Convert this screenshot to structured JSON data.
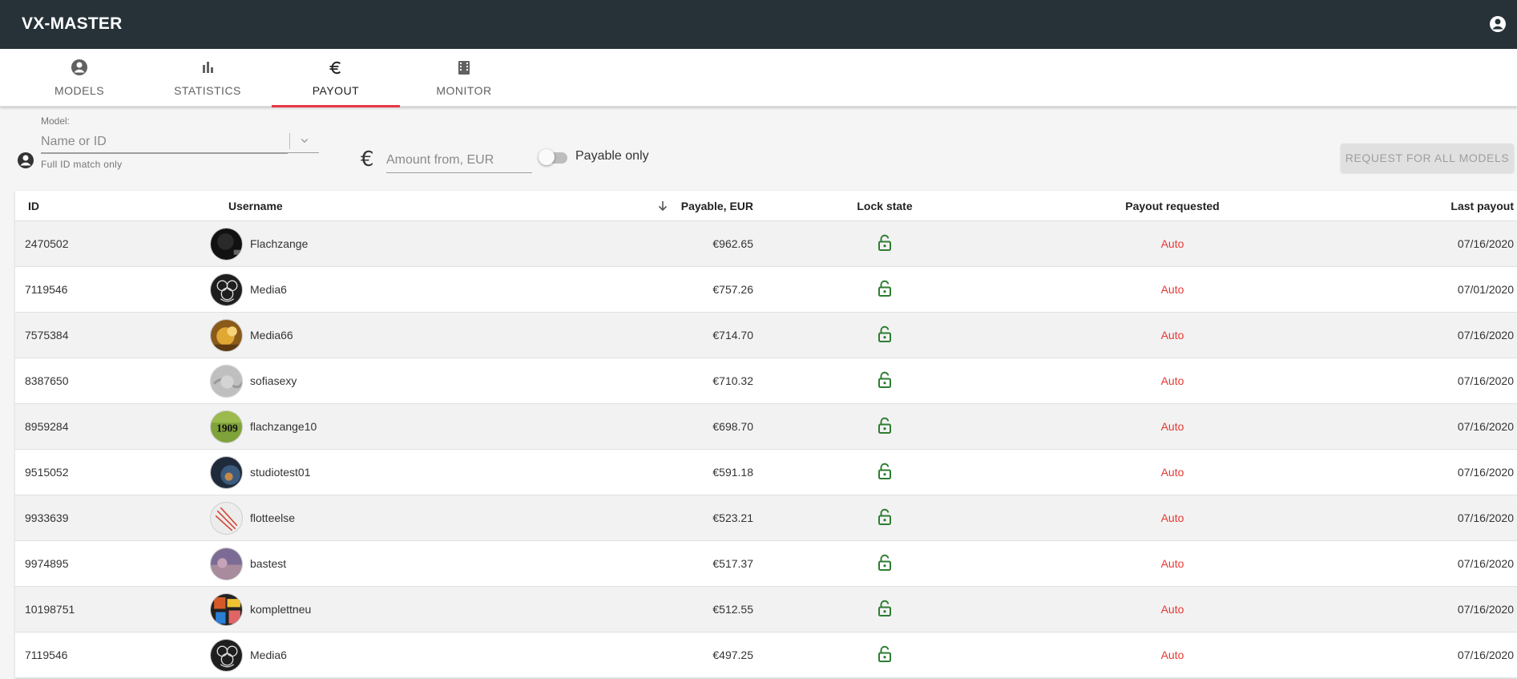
{
  "app": {
    "title": "VX-MASTER"
  },
  "tabs": [
    {
      "label": "MODELS",
      "icon": "account-circle-icon"
    },
    {
      "label": "STATISTICS",
      "icon": "bar-chart-icon"
    },
    {
      "label": "PAYOUT",
      "icon": "euro-icon",
      "active": true
    },
    {
      "label": "MONITOR",
      "icon": "video-monitor-icon"
    }
  ],
  "filters": {
    "model_label": "Model:",
    "model_placeholder": "Name or ID",
    "model_hint": "Full ID match only",
    "amount_placeholder": "Amount from, EUR",
    "payable_only_label": "Payable only",
    "payable_only_checked": false,
    "request_button": "REQUEST FOR ALL MODELS"
  },
  "table": {
    "headers": {
      "id": "ID",
      "username": "Username",
      "payable": "Payable, EUR",
      "lock_state": "Lock state",
      "payout_requested": "Payout requested",
      "last_payout": "Last payout"
    },
    "sort": {
      "column": "payable",
      "direction": "desc"
    },
    "rows": [
      {
        "id": "2470502",
        "username": "Flachzange",
        "payable": "€962.65",
        "lock": "unlocked",
        "requested": "Auto",
        "last": "07/16/2020",
        "avatar": "dark"
      },
      {
        "id": "7119546",
        "username": "Media6",
        "payable": "€757.26",
        "lock": "unlocked",
        "requested": "Auto",
        "last": "07/01/2020",
        "avatar": "ornament"
      },
      {
        "id": "7575384",
        "username": "Media66",
        "payable": "€714.70",
        "lock": "unlocked",
        "requested": "Auto",
        "last": "07/16/2020",
        "avatar": "gold"
      },
      {
        "id": "8387650",
        "username": "sofiasexy",
        "payable": "€710.32",
        "lock": "unlocked",
        "requested": "Auto",
        "last": "07/16/2020",
        "avatar": "grey"
      },
      {
        "id": "8959284",
        "username": "flachzange10",
        "payable": "€698.70",
        "lock": "unlocked",
        "requested": "Auto",
        "last": "07/16/2020",
        "avatar": "year"
      },
      {
        "id": "9515052",
        "username": "studiotest01",
        "payable": "€591.18",
        "lock": "unlocked",
        "requested": "Auto",
        "last": "07/16/2020",
        "avatar": "night"
      },
      {
        "id": "9933639",
        "username": "flotteelse",
        "payable": "€523.21",
        "lock": "unlocked",
        "requested": "Auto",
        "last": "07/16/2020",
        "avatar": "sketch"
      },
      {
        "id": "9974895",
        "username": "bastest",
        "payable": "€517.37",
        "lock": "unlocked",
        "requested": "Auto",
        "last": "07/16/2020",
        "avatar": "purple"
      },
      {
        "id": "10198751",
        "username": "komplettneu",
        "payable": "€512.55",
        "lock": "unlocked",
        "requested": "Auto",
        "last": "07/16/2020",
        "avatar": "collage"
      },
      {
        "id": "7119546",
        "username": "Media6",
        "payable": "€497.25",
        "lock": "unlocked",
        "requested": "Auto",
        "last": "07/16/2020",
        "avatar": "ornament"
      }
    ],
    "avatar_text": {
      "year": "1909"
    }
  },
  "colors": {
    "topbar": "#263238",
    "accent": "#e53945",
    "lock_green": "#2e7d32",
    "auto_red": "#e53935"
  }
}
